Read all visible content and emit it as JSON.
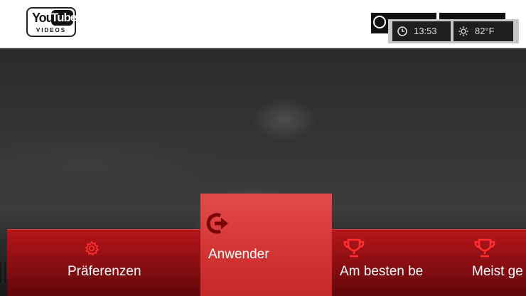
{
  "logo": {
    "part1": "You",
    "part2": "Tube",
    "sub": "VIDEOS"
  },
  "status": {
    "time": "13:53",
    "temperature": "82°F",
    "time_icon": "clock-icon",
    "weather_icon": "sun-icon"
  },
  "menu": {
    "items": [
      {
        "label": "Präferenzen",
        "icon": "gear-icon"
      },
      {
        "label": "Anwender",
        "icon": "login-arrow-icon",
        "selected": true
      },
      {
        "label": "Am besten be",
        "icon": "trophy-icon"
      },
      {
        "label": "Meist ge",
        "icon": "trophy-icon"
      }
    ]
  },
  "colors": {
    "accent": "#d23333",
    "bar": "#9a1014",
    "icon": "#ff2d2d"
  }
}
